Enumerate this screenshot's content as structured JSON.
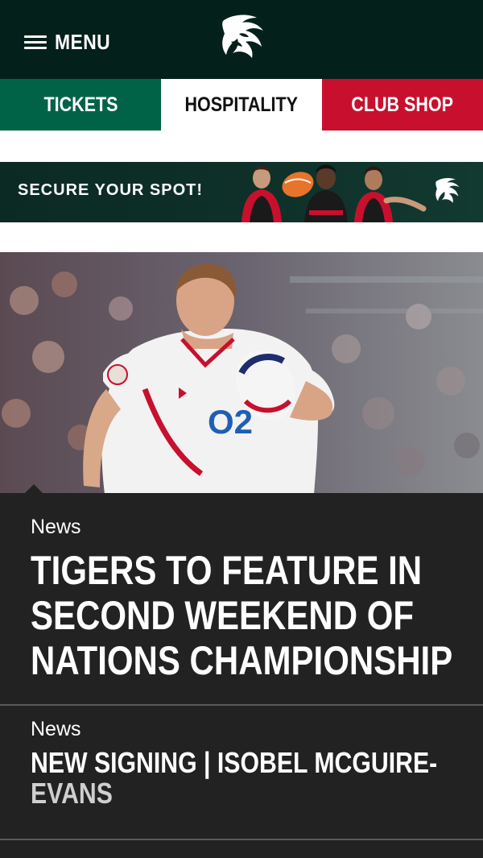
{
  "header": {
    "menu_label": "MENU",
    "logo_icon": "tiger-logo-icon"
  },
  "nav": {
    "tabs": [
      {
        "label": "TICKETS",
        "color": "#006347"
      },
      {
        "label": "HOSPITALITY",
        "color": "#ffffff"
      },
      {
        "label": "CLUB SHOP",
        "color": "#c8102e"
      }
    ]
  },
  "banner": {
    "text": "SECURE YOUR SPOT!"
  },
  "articles": [
    {
      "category": "News",
      "title": "TIGERS TO FEATURE IN SECOND WEEKEND OF NATIONS CHAMPIONSHIP"
    },
    {
      "category": "News",
      "title_main": "NEW SIGNING | ISOBEL MCGUIRE-",
      "title_fade": "EVANS"
    }
  ],
  "colors": {
    "header_bg": "#04201a",
    "card_bg": "#222222",
    "tickets": "#006347",
    "shop": "#c8102e"
  }
}
